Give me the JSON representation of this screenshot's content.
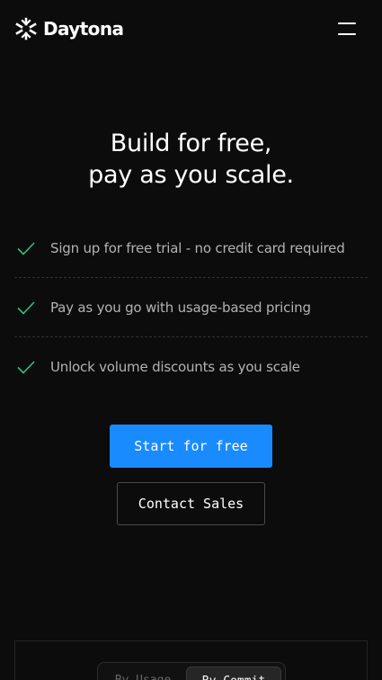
{
  "header": {
    "brand_name": "Daytona",
    "logo_icon": "daytona-star-logo",
    "menu_icon": "hamburger-menu-icon"
  },
  "hero": {
    "title_line1": "Build for free,",
    "title_line2": "pay as you scale."
  },
  "features": [
    {
      "icon": "checkmark-icon",
      "text": "Sign up for free trial - no credit card required"
    },
    {
      "icon": "checkmark-icon",
      "text": "Pay as you go with usage-based pricing"
    },
    {
      "icon": "checkmark-icon",
      "text": "Unlock volume discounts as you scale"
    }
  ],
  "actions": {
    "primary_label": "Start for free",
    "secondary_label": "Contact Sales"
  },
  "pricing_toggle": {
    "options": [
      "By Usage",
      "By Commit"
    ],
    "selected_index": 1
  },
  "colors": {
    "background": "#0c0c0c",
    "accent": "#1a8bff",
    "check": "#2ec27e",
    "muted_text": "#b3b3b3"
  }
}
